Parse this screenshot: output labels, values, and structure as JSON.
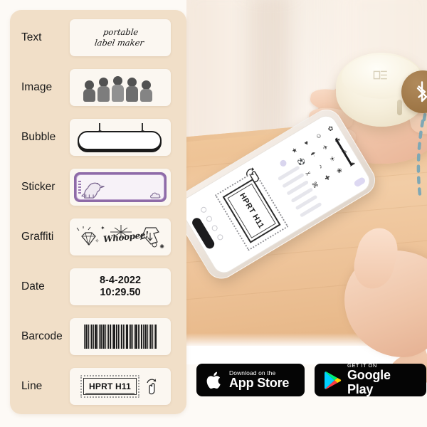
{
  "panel": {
    "rows": [
      {
        "label": "Text",
        "type": "text",
        "line1": "portable",
        "line2": "label maker"
      },
      {
        "label": "Image",
        "type": "image",
        "alt": "group of five people photo"
      },
      {
        "label": "Bubble",
        "type": "bubble",
        "alt": "hanging sign bubble label"
      },
      {
        "label": "Sticker",
        "type": "sticker",
        "alt": "purple dinosaur sticker frame"
      },
      {
        "label": "Graffiti",
        "type": "graffiti",
        "word": "Whoopee!"
      },
      {
        "label": "Date",
        "type": "date",
        "line1": "8-4-2022",
        "line2": "10:29.50"
      },
      {
        "label": "Barcode",
        "type": "barcode",
        "alt": "barcode"
      },
      {
        "label": "Line",
        "type": "line",
        "value": "HPRT H11"
      }
    ]
  },
  "scene": {
    "bluetooth_icon": "bluetooth-icon",
    "printer_alt": "round pocket label printer held in hand",
    "phone_alt": "smartphone running label maker app held in hand",
    "app": {
      "label_text": "HPRT H11",
      "rotate_icon": "rotate-handle-icon",
      "sticker_icons": [
        "★",
        "♥",
        "☺",
        "✿",
        "⚽",
        "☂",
        "✈",
        "☘",
        "✂",
        "♪",
        "☀",
        "✎",
        "⌘",
        "✚",
        "❀",
        "☁"
      ]
    }
  },
  "store_badges": [
    {
      "name": "app-store",
      "small": "Download on the",
      "big": "App Store",
      "icon": "apple-icon"
    },
    {
      "name": "google-play",
      "small": "GET IT ON",
      "big": "Google Play",
      "icon": "google-play-icon"
    }
  ],
  "colors": {
    "panel_bg": "#f1dfc8",
    "card_bg": "#fbf7f1",
    "bluetooth_badge": "#9d7545",
    "dash_line": "#7fa8b5",
    "sticker_frame": "#8e6ba8",
    "desk_wood": "#eec396",
    "badge_bg": "#050505"
  }
}
